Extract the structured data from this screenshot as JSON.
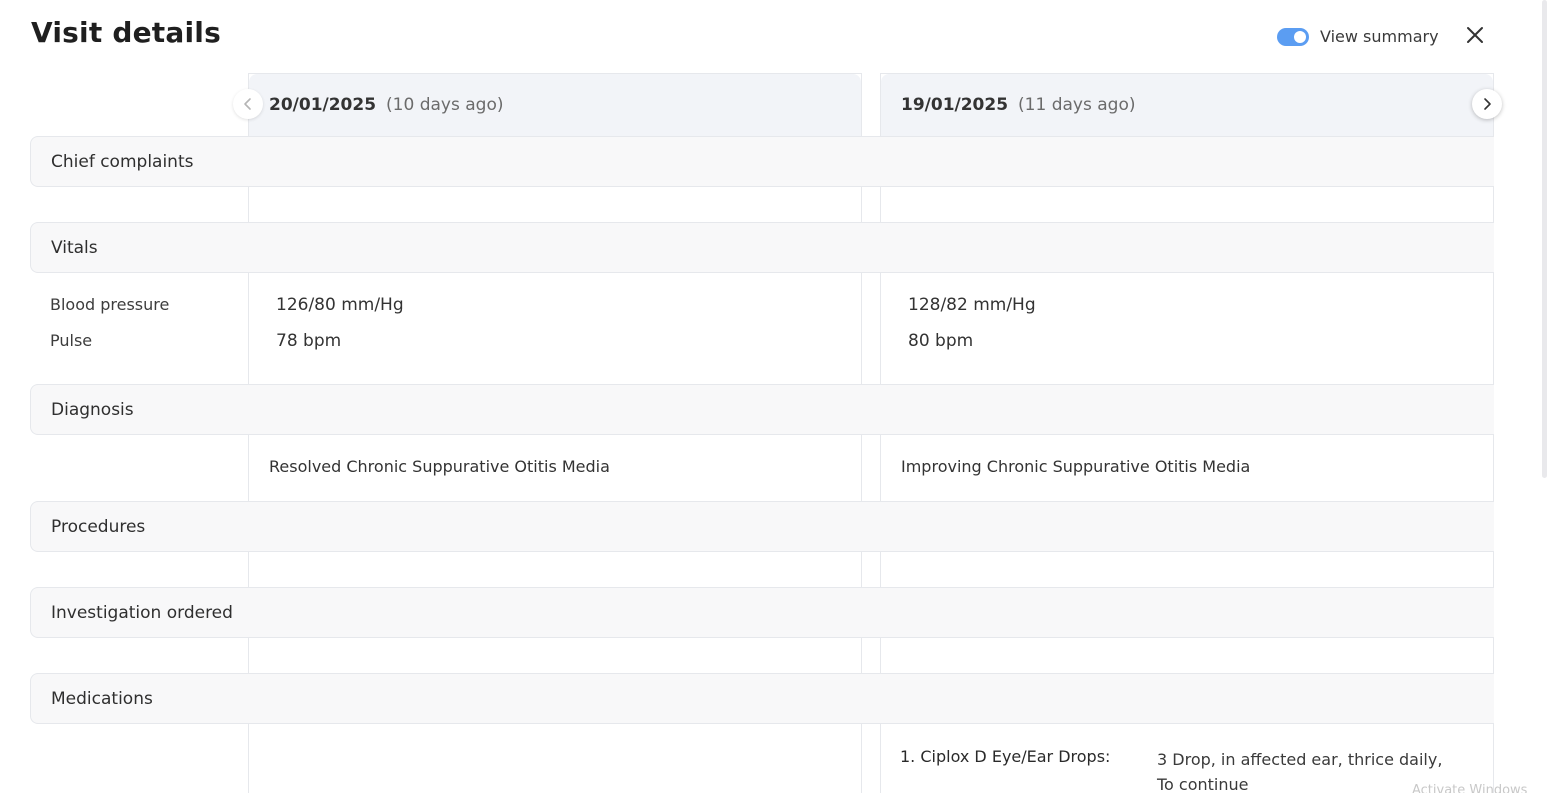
{
  "header": {
    "title": "Visit details",
    "summary_label": "View summary",
    "summary_enabled": true
  },
  "visits": [
    {
      "date": "20/01/2025",
      "ago": "(10 days ago)",
      "vitals": {
        "blood_pressure": "126/80 mm/Hg",
        "pulse": "78 bpm"
      },
      "diagnosis": "Resolved Chronic Suppurative Otitis Media"
    },
    {
      "date": "19/01/2025",
      "ago": "(11 days ago)",
      "vitals": {
        "blood_pressure": "128/82 mm/Hg",
        "pulse": "80 bpm"
      },
      "diagnosis": "Improving Chronic Suppurative Otitis Media",
      "medications": [
        {
          "name": "1. Ciplox D Eye/Ear Drops:",
          "dosage_line1": "3 Drop, in affected ear, thrice daily,",
          "dosage_line2": "To continue"
        }
      ]
    }
  ],
  "sections": {
    "chief_complaints": "Chief complaints",
    "vitals": "Vitals",
    "diagnosis": "Diagnosis",
    "procedures": "Procedures",
    "investigation": "Investigation ordered",
    "medications": "Medications"
  },
  "vital_labels": {
    "blood_pressure": "Blood pressure",
    "pulse": "Pulse"
  },
  "icons": {
    "close": "close-icon",
    "prev": "chevron-left-icon",
    "next": "chevron-right-icon"
  },
  "colors": {
    "toggle_accent": "#5b9df2",
    "column_header_bg": "#f2f4f8",
    "section_bg": "#f8f8f9"
  },
  "watermark": "Activate Windows"
}
